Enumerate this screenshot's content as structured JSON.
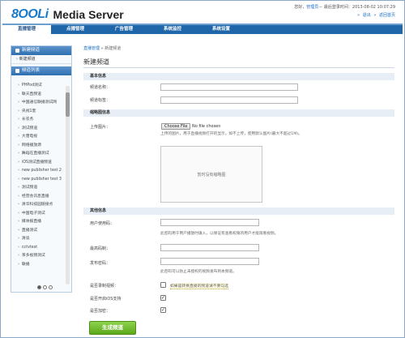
{
  "header": {
    "logo_mark": "8OOLi",
    "app_title": "Media Server",
    "greeting": "您好，",
    "user": "管理员",
    "login_prefix": "－ 最后登录时间：",
    "login_time": "2013-08-02 10:07:29",
    "links": [
      "退出",
      "返回首页"
    ]
  },
  "nav": {
    "items": [
      "直播管理",
      "点播管理",
      "广告管理",
      "系统监控",
      "系统设置"
    ],
    "active": 0
  },
  "sidebar": {
    "new_channel_header": "新建频道",
    "new_channel_sub": "新建频道",
    "channel_list_header": "频道列表",
    "channels": [
      "PHPod测试",
      "联天直频道",
      "中国通信联播测试网",
      "央视1套",
      "长农务",
      "测试频道",
      "大唐电视",
      "网络播放源",
      "舞蹈在直播测试",
      "iOS测试直播频道",
      "new publisher test 2",
      "new publisher test 3",
      "测试频道",
      "经营会讯息直播",
      "清华科技园链接点",
      "中国电子测试",
      "媒体报直播",
      "直播测试",
      "清谈",
      "cctvtest",
      "茶多视频测试",
      "联播"
    ]
  },
  "main": {
    "breadcrumb_link": "直播管理",
    "breadcrumb_sep": " » ",
    "breadcrumb_current": "新建频道",
    "title": "新建频道",
    "basic_section": "基本信息",
    "channel_name_label": "频道名称：",
    "channel_tag_label": "频道标签：",
    "thumb_section": "缩略图信息",
    "upload_label": "上传图片：",
    "file_button": "Choose File",
    "file_none": "No file chosen",
    "upload_hint": "上传的图片，用于直播视频打开的显示。如不上传，使用默认图片(最大不超过1M)。",
    "preview_text": "暂时没有缩略图",
    "other_section": "其他信息",
    "user_id_label": "用户使用码：",
    "user_id_hint": "此密码用于用户播放时填入，以保证有查看权限的用户才能观看视频。",
    "max_bitrate_label": "最高码制：",
    "publish_pwd_label": "发布密码：",
    "publish_pwd_hint": "此密码可以防止未授权的视频发布到本频道。",
    "record_label": "是否录制视频：",
    "record_note": "如果是转换直播的频道请不要勾选",
    "ios_label": "是否开启iOS支持",
    "encrypt_label": "是否加密：",
    "submit_label": "生成频道",
    "checkboxes": {
      "record": false,
      "ios": true,
      "encrypt": true
    }
  },
  "colors": {
    "nav_bg": "#1f67a8",
    "link": "#1a6fc2",
    "submit": "#6ab82a"
  }
}
